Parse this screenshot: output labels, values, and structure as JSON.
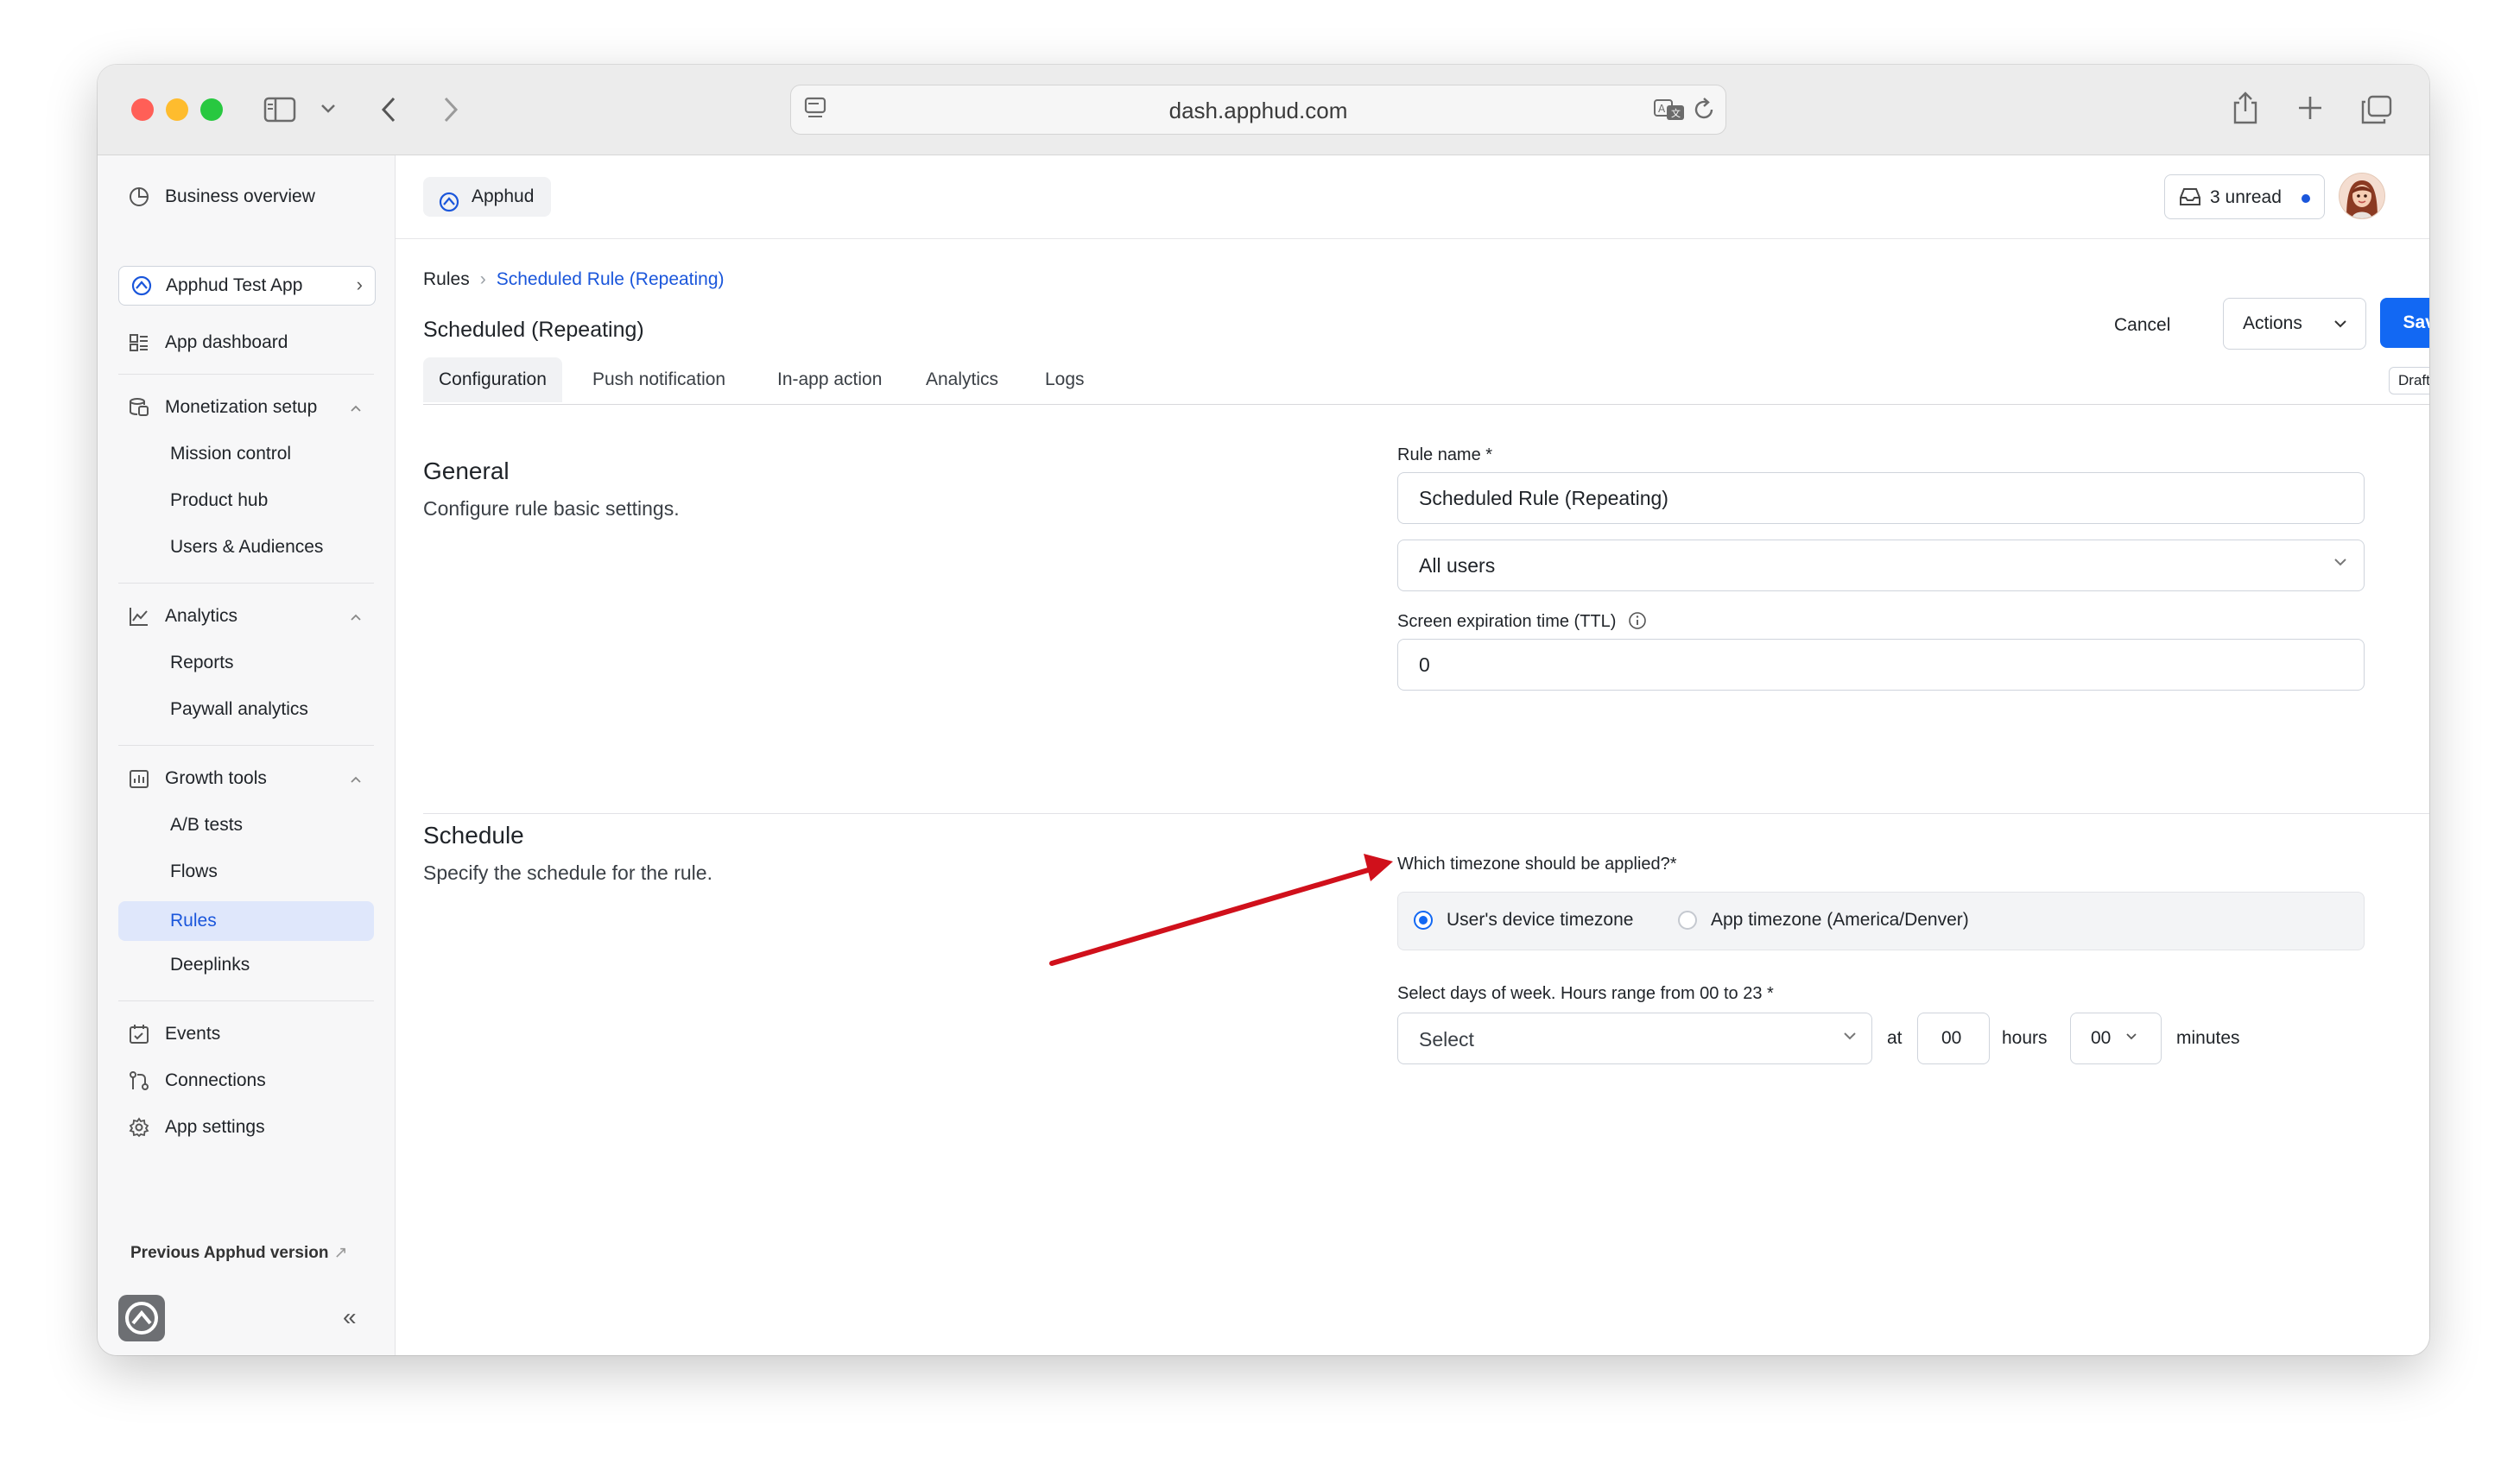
{
  "browser": {
    "url": "dash.apphud.com"
  },
  "sidebar": {
    "business_overview": "Business overview",
    "app_selector": "Apphud Test App",
    "app_dashboard": "App dashboard",
    "monetization": {
      "label": "Monetization setup",
      "items": [
        "Mission control",
        "Product hub",
        "Users & Audiences"
      ]
    },
    "analytics": {
      "label": "Analytics",
      "items": [
        "Reports",
        "Paywall analytics"
      ]
    },
    "growth": {
      "label": "Growth tools",
      "items": [
        "A/B tests",
        "Flows",
        "Rules",
        "Deeplinks"
      ],
      "active": "Rules"
    },
    "events": "Events",
    "connections": "Connections",
    "app_settings": "App settings",
    "previous_version": "Previous Apphud version"
  },
  "topbar": {
    "org": "Apphud",
    "unread": "3 unread"
  },
  "breadcrumb": {
    "root": "Rules",
    "current": "Scheduled Rule (Repeating)"
  },
  "page": {
    "title": "Scheduled (Repeating)",
    "cancel": "Cancel",
    "actions": "Actions",
    "save": "Save",
    "status": "Draft"
  },
  "tabs": [
    "Configuration",
    "Push notification",
    "In-app action",
    "Analytics",
    "Logs"
  ],
  "general": {
    "title": "General",
    "description": "Configure rule basic settings.",
    "rule_name_label": "Rule name *",
    "rule_name_value": "Scheduled Rule (Repeating)",
    "audience_value": "All users",
    "ttl_label": "Screen expiration time (TTL)",
    "ttl_value": "0"
  },
  "schedule": {
    "title": "Schedule",
    "description": "Specify the schedule for the rule.",
    "timezone_label": "Which timezone should be applied?*",
    "timezone_options": [
      "User's device timezone",
      "App timezone (America/Denver)"
    ],
    "timezone_selected": "User's device timezone",
    "days_label": "Select days of week. Hours range from 00 to 23 *",
    "days_placeholder": "Select",
    "at": "at",
    "hours_value": "00",
    "hours_label": "hours",
    "minutes_value": "00",
    "minutes_label": "minutes"
  },
  "colors": {
    "accent": "#1268f3",
    "annotation_arrow": "#d0101b"
  }
}
